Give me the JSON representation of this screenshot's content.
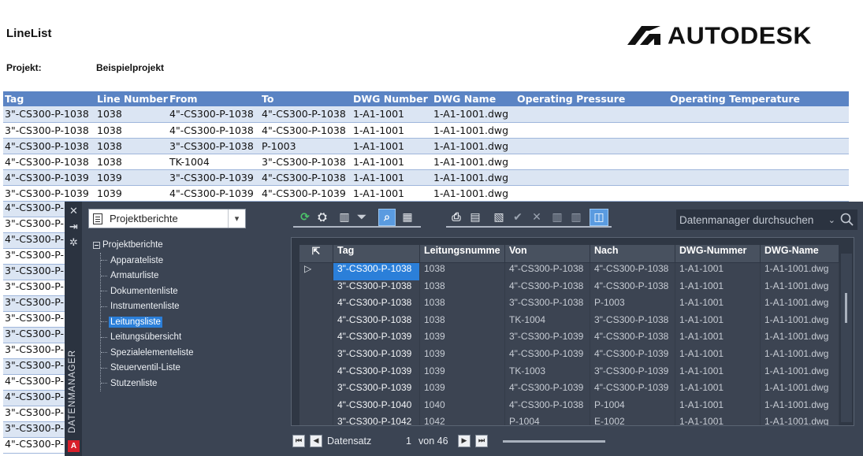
{
  "report": {
    "title": "LineList",
    "brand": "AUTODESK",
    "project_label": "Projekt:",
    "project_value": "Beispielprojekt",
    "columns": [
      "Tag",
      "Line Number",
      "From",
      "To",
      "DWG Number",
      "DWG Name",
      "Operating Pressure",
      "Operating Temperature"
    ],
    "rows": [
      [
        "3\"-CS300-P-1038",
        "1038",
        "4\"-CS300-P-1038",
        "4\"-CS300-P-1038",
        "1-A1-1001",
        "1-A1-1001.dwg",
        "",
        ""
      ],
      [
        "3\"-CS300-P-1038",
        "1038",
        "4\"-CS300-P-1038",
        "4\"-CS300-P-1038",
        "1-A1-1001",
        "1-A1-1001.dwg",
        "",
        ""
      ],
      [
        "4\"-CS300-P-1038",
        "1038",
        "3\"-CS300-P-1038",
        "P-1003",
        "1-A1-1001",
        "1-A1-1001.dwg",
        "",
        ""
      ],
      [
        "4\"-CS300-P-1038",
        "1038",
        "TK-1004",
        "3\"-CS300-P-1038",
        "1-A1-1001",
        "1-A1-1001.dwg",
        "",
        ""
      ],
      [
        "4\"-CS300-P-1039",
        "1039",
        "3\"-CS300-P-1039",
        "4\"-CS300-P-1038",
        "1-A1-1001",
        "1-A1-1001.dwg",
        "",
        ""
      ],
      [
        "3\"-CS300-P-1039",
        "1039",
        "4\"-CS300-P-1039",
        "4\"-CS300-P-1039",
        "1-A1-1001",
        "1-A1-1001.dwg",
        "",
        ""
      ]
    ],
    "partial_rows": [
      "4\"-CS300-P-1",
      "3\"-CS300-P-1",
      "4\"-CS300-P-1",
      "3\"-CS300-P-1",
      "3\"-CS300-P-1",
      "3\"-CS300-P-1",
      "3\"-CS300-P-1",
      "3\"-CS300-P-1",
      "3\"-CS300-P-1",
      "3\"-CS300-P-1",
      "3\"-CS300-P-1",
      "4\"-CS300-P-1",
      "4\"-CS300-P-1",
      "3\"-CS300-P-1",
      "3\"-CS300-P-1",
      "4\"-CS300-P-1"
    ]
  },
  "palette": {
    "side_label": "DATENMANAGER",
    "badge": "A",
    "report_select": "Projektberichte",
    "search_placeholder": "Datenmanager durchsuchen",
    "tree": {
      "root": "Projektberichte",
      "items": [
        "Apparateliste",
        "Armaturliste",
        "Dokumentenliste",
        "Instrumentenliste",
        "Leitungsliste",
        "Leitungsübersicht",
        "Spezialelementeliste",
        "Steuerventil-Liste",
        "Stutzenliste"
      ],
      "selected_index": 4
    },
    "grid": {
      "columns": [
        "Tag",
        "Leitungsnumme",
        "Von",
        "Nach",
        "DWG-Nummer",
        "DWG-Name"
      ],
      "rows": [
        [
          "3\"-CS300-P-1038",
          "1038",
          "4\"-CS300-P-1038",
          "4\"-CS300-P-1038",
          "1-A1-1001",
          "1-A1-1001.dwg"
        ],
        [
          "3\"-CS300-P-1038",
          "1038",
          "4\"-CS300-P-1038",
          "4\"-CS300-P-1038",
          "1-A1-1001",
          "1-A1-1001.dwg"
        ],
        [
          "4\"-CS300-P-1038",
          "1038",
          "3\"-CS300-P-1038",
          "P-1003",
          "1-A1-1001",
          "1-A1-1001.dwg"
        ],
        [
          "4\"-CS300-P-1038",
          "1038",
          "TK-1004",
          "3\"-CS300-P-1038",
          "1-A1-1001",
          "1-A1-1001.dwg"
        ],
        [
          "4\"-CS300-P-1039",
          "1039",
          "3\"-CS300-P-1039",
          "4\"-CS300-P-1038",
          "1-A1-1001",
          "1-A1-1001.dwg"
        ],
        [
          "3\"-CS300-P-1039",
          "1039",
          "4\"-CS300-P-1039",
          "4\"-CS300-P-1039",
          "1-A1-1001",
          "1-A1-1001.dwg"
        ],
        [
          "4\"-CS300-P-1039",
          "1039",
          "TK-1003",
          "3\"-CS300-P-1039",
          "1-A1-1001",
          "1-A1-1001.dwg"
        ],
        [
          "3\"-CS300-P-1039",
          "1039",
          "4\"-CS300-P-1039",
          "4\"-CS300-P-1039",
          "1-A1-1001",
          "1-A1-1001.dwg"
        ],
        [
          "4\"-CS300-P-1040",
          "1040",
          "4\"-CS300-P-1038",
          "P-1004",
          "1-A1-1001",
          "1-A1-1001.dwg"
        ],
        [
          "3\"-CS300-P-1042",
          "1042",
          "P-1004",
          "E-1002",
          "1-A1-1001",
          "1-A1-1001.dwg"
        ]
      ],
      "current_row": 0
    },
    "footer": {
      "record_label": "Datensatz",
      "record_current": "1",
      "record_of": "von 46"
    }
  },
  "colors": {
    "report_header": "#5b84c4",
    "report_stripe": "#dbe5f3",
    "palette_bg": "#3b4453",
    "selection": "#2b7fd9"
  }
}
